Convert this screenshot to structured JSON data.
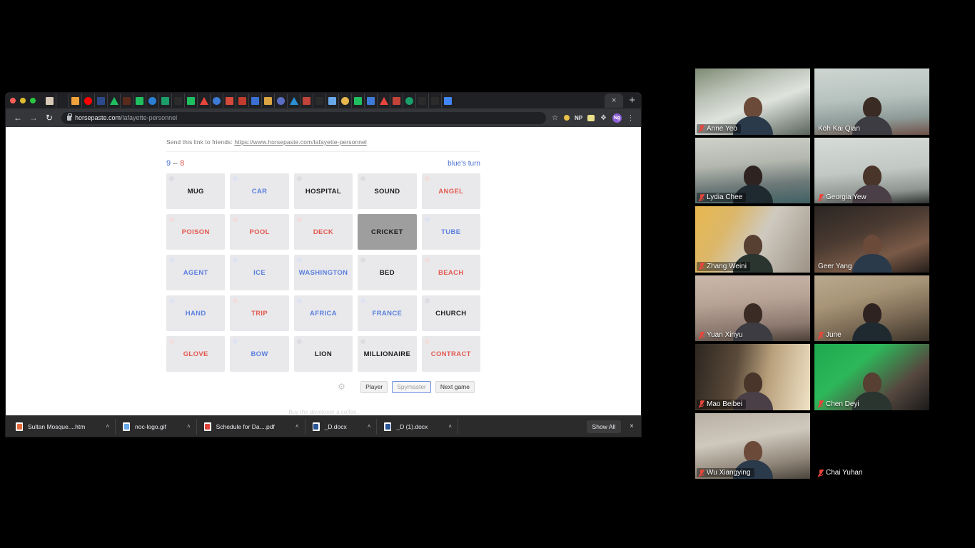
{
  "browser": {
    "window_controls": [
      "close",
      "minimize",
      "maximize"
    ],
    "pinned_tabs": [
      {
        "name": "tab-favicon-1",
        "color": "#d9c9b8"
      },
      {
        "name": "tab-favicon-2",
        "color": "#202124"
      },
      {
        "name": "tab-favicon-3",
        "color": "#f0a13c"
      },
      {
        "name": "tab-favicon-4",
        "color": "#ff0000"
      },
      {
        "name": "tab-favicon-5",
        "color": "#2b4a8b"
      },
      {
        "name": "tab-favicon-6",
        "color": "#1fbf60"
      },
      {
        "name": "tab-favicon-7",
        "color": "#5a2a1c"
      },
      {
        "name": "tab-favicon-8",
        "color": "#1fbf60"
      },
      {
        "name": "tab-favicon-9",
        "color": "#2b7fd4"
      },
      {
        "name": "tab-favicon-10",
        "color": "#1a9e6a"
      },
      {
        "name": "tab-favicon-11",
        "color": "#2b2b2b"
      },
      {
        "name": "tab-favicon-12",
        "color": "#1fbf60"
      },
      {
        "name": "tab-favicon-13",
        "color": "#e8453c"
      },
      {
        "name": "tab-favicon-14",
        "color": "#3d7bd6"
      },
      {
        "name": "tab-favicon-15",
        "color": "#d64a3c"
      },
      {
        "name": "tab-favicon-16",
        "color": "#c23b2e"
      },
      {
        "name": "tab-favicon-17",
        "color": "#3b6fd4"
      },
      {
        "name": "tab-favicon-18",
        "color": "#d9a441"
      },
      {
        "name": "tab-favicon-19",
        "color": "#5a6fc4"
      },
      {
        "name": "tab-favicon-20",
        "color": "#2b8fd4"
      },
      {
        "name": "tab-favicon-21",
        "color": "#c2433a"
      },
      {
        "name": "tab-favicon-22",
        "color": "#2b2b2b"
      },
      {
        "name": "tab-favicon-23",
        "color": "#6aa9e9"
      },
      {
        "name": "tab-favicon-24",
        "color": "#e8b84e"
      },
      {
        "name": "tab-favicon-25",
        "color": "#1fbf60"
      },
      {
        "name": "tab-favicon-26",
        "color": "#3d7bd6"
      },
      {
        "name": "tab-favicon-27",
        "color": "#e8453c"
      },
      {
        "name": "tab-favicon-28",
        "color": "#c2433a"
      },
      {
        "name": "tab-favicon-29",
        "color": "#1a9e6a"
      },
      {
        "name": "tab-favicon-30",
        "color": "#2b2b2b"
      },
      {
        "name": "tab-favicon-31",
        "color": "#2b2b2b"
      },
      {
        "name": "tab-favicon-32",
        "color": "#4285f4"
      }
    ],
    "active_tab_close_label": "×",
    "new_tab_label": "+",
    "back_label": "←",
    "forward_label": "→",
    "reload_label": "↻",
    "url_host": "horsepaste.com",
    "url_path": "/lafayette-personnel",
    "star_label": "☆",
    "extension_np_label": "NP",
    "puzzle_label": "❖",
    "profile_initials": "Ng",
    "menu_label": "⋮"
  },
  "game": {
    "send_link_prefix": "Send this link to friends:",
    "send_link_url": "https://www.horsepaste.com/lafayette-personnel",
    "score_blue": "9",
    "score_dash": "–",
    "score_red": "8",
    "turn_text": "blue's turn",
    "colors": {
      "blue": "#5b7fdc",
      "red": "#e2594f",
      "neutral": "#e9e9ec",
      "revealed_gray": "#9e9e9e"
    },
    "board": [
      {
        "word": "MUG",
        "team": "black"
      },
      {
        "word": "CAR",
        "team": "blue"
      },
      {
        "word": "HOSPITAL",
        "team": "black"
      },
      {
        "word": "SOUND",
        "team": "black"
      },
      {
        "word": "ANGEL",
        "team": "red"
      },
      {
        "word": "POISON",
        "team": "red"
      },
      {
        "word": "POOL",
        "team": "red"
      },
      {
        "word": "DECK",
        "team": "red"
      },
      {
        "word": "CRICKET",
        "team": "revealed-neutral"
      },
      {
        "word": "TUBE",
        "team": "blue"
      },
      {
        "word": "AGENT",
        "team": "blue"
      },
      {
        "word": "ICE",
        "team": "blue"
      },
      {
        "word": "WASHINGTON",
        "team": "blue"
      },
      {
        "word": "BED",
        "team": "black"
      },
      {
        "word": "BEACH",
        "team": "red"
      },
      {
        "word": "HAND",
        "team": "blue"
      },
      {
        "word": "TRIP",
        "team": "red"
      },
      {
        "word": "AFRICA",
        "team": "blue"
      },
      {
        "word": "FRANCE",
        "team": "blue"
      },
      {
        "word": "CHURCH",
        "team": "black"
      },
      {
        "word": "GLOVE",
        "team": "red"
      },
      {
        "word": "BOW",
        "team": "blue"
      },
      {
        "word": "LION",
        "team": "black"
      },
      {
        "word": "MILLIONAIRE",
        "team": "black"
      },
      {
        "word": "CONTRACT",
        "team": "red"
      }
    ],
    "gear_label": "⚙",
    "btn_player": "Player",
    "btn_spymaster": "Spymaster",
    "btn_next_game": "Next game",
    "coffee_text": "Buy the developer a coffee."
  },
  "downloads": {
    "items": [
      {
        "name": "Sultan Mosque....htm",
        "type": "htm",
        "caret": "˄"
      },
      {
        "name": "noc-logo.gif",
        "type": "gif",
        "caret": "˄"
      },
      {
        "name": "Schedule for Da....pdf",
        "type": "pdf",
        "caret": "˄"
      },
      {
        "name": "_D.docx",
        "type": "docx",
        "caret": "˄"
      },
      {
        "name": "_D (1).docx",
        "type": "docx",
        "caret": "˄"
      }
    ],
    "show_all_label": "Show All",
    "close_label": "×"
  },
  "video_call": {
    "participants": [
      {
        "name": "Anne Yeo",
        "muted": true,
        "camera_off": false,
        "bg": "bg-anne",
        "plate_bg": true
      },
      {
        "name": "Koh Kai Qian",
        "muted": false,
        "camera_off": false,
        "bg": "bg-koh",
        "plate_bg": false
      },
      {
        "name": "Lydia Chee",
        "muted": true,
        "camera_off": false,
        "bg": "bg-lydia",
        "plate_bg": true
      },
      {
        "name": "Georgia Yew",
        "muted": true,
        "camera_off": false,
        "bg": "bg-georgia",
        "plate_bg": false
      },
      {
        "name": "Zhang Weini",
        "muted": true,
        "camera_off": false,
        "bg": "bg-zhang",
        "plate_bg": true
      },
      {
        "name": "Geer Yang",
        "muted": false,
        "camera_off": false,
        "bg": "bg-geer",
        "plate_bg": false
      },
      {
        "name": "Yuan Xinyu",
        "muted": true,
        "camera_off": false,
        "bg": "bg-yuan",
        "plate_bg": false
      },
      {
        "name": "June",
        "muted": true,
        "camera_off": false,
        "bg": "bg-june",
        "plate_bg": false
      },
      {
        "name": "Mao Beibei",
        "muted": true,
        "camera_off": false,
        "bg": "bg-mao",
        "plate_bg": true
      },
      {
        "name": "Chen Deyi",
        "muted": true,
        "camera_off": false,
        "bg": "bg-chen",
        "plate_bg": false
      },
      {
        "name": "Wu Xiangying",
        "muted": true,
        "camera_off": false,
        "bg": "bg-wu",
        "plate_bg": true
      },
      {
        "name": "Chai Yuhan",
        "muted": true,
        "camera_off": true,
        "bg": "bg-off",
        "plate_bg": false
      }
    ]
  }
}
